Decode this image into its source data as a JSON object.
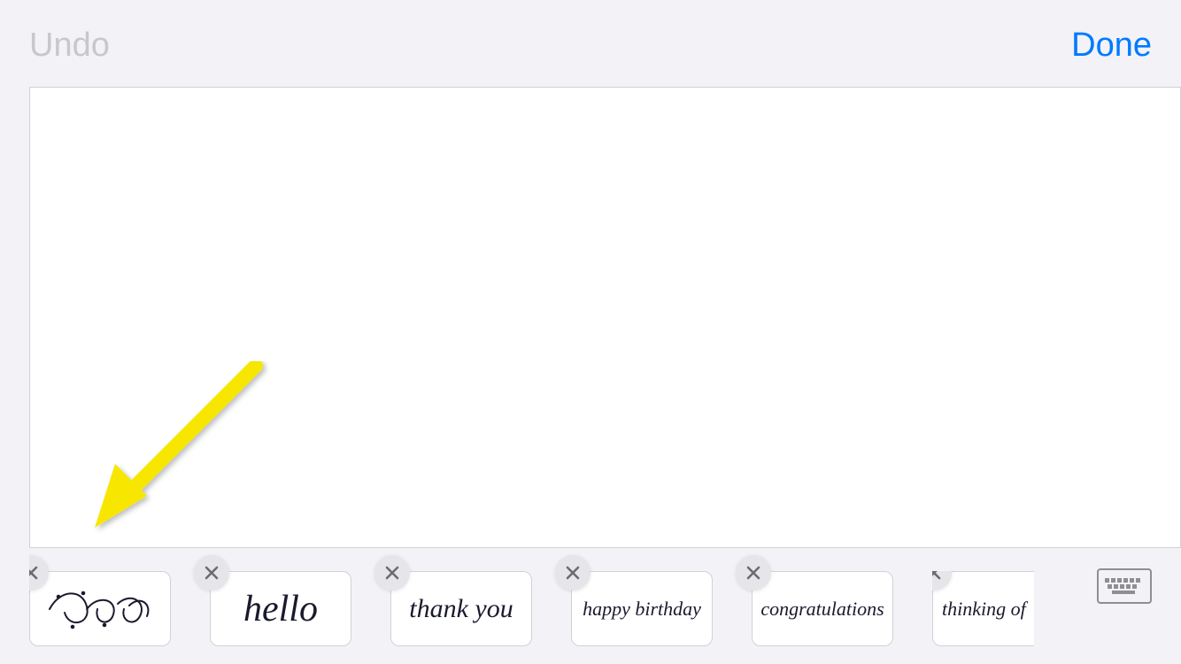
{
  "header": {
    "undo_label": "Undo",
    "done_label": "Done"
  },
  "presets": [
    {
      "label": "scribble",
      "kind": "scribble"
    },
    {
      "label": "hello",
      "kind": "text"
    },
    {
      "label": "thank you",
      "kind": "text"
    },
    {
      "label": "happy birthday",
      "kind": "text"
    },
    {
      "label": "congratulations",
      "kind": "text"
    },
    {
      "label": "thinking of",
      "kind": "text",
      "cutoff": true
    }
  ],
  "colors": {
    "accent": "#007aff",
    "disabled": "#c7c7cc",
    "ink": "#1a1a2e",
    "annotation": "#f7e600"
  },
  "icons": {
    "close": "close-icon",
    "keyboard": "keyboard-icon",
    "arrow": "arrow-annotation"
  }
}
